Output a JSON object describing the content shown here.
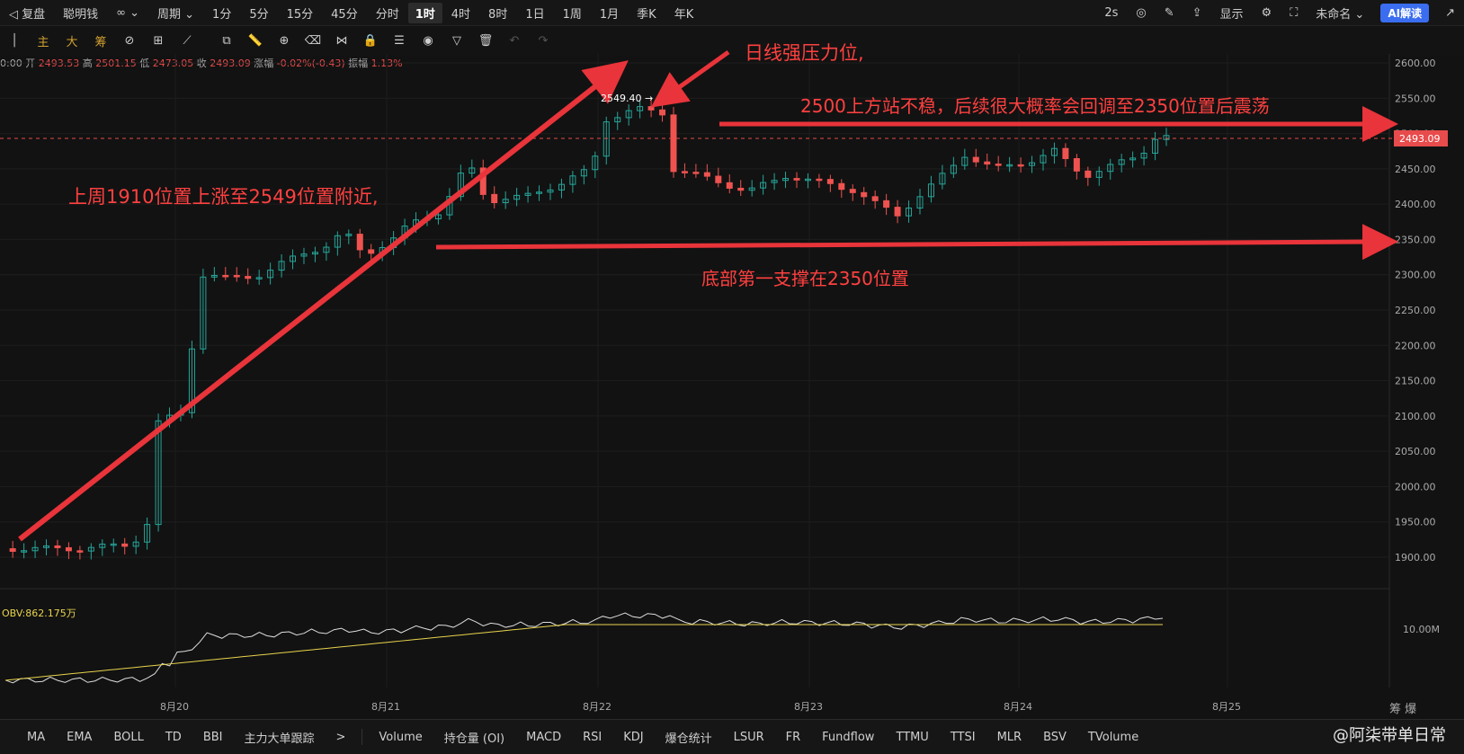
{
  "topbar": {
    "left_items": [
      "◁ 复盘",
      "聪明钱",
      "周期 ⌄"
    ],
    "period_options": [
      "1分",
      "5分",
      "15分",
      "45分",
      "分时",
      "1时",
      "4时",
      "8时",
      "1日",
      "1周",
      "1月",
      "季K",
      "年K"
    ],
    "active_period": "1时",
    "refresh": "2s",
    "display_label": "显示",
    "unnamed_label": "未命名 ⌄",
    "ai_label": "AI解读"
  },
  "drawing_tools": [
    "主",
    "大",
    "筹"
  ],
  "ohlc": {
    "time": "0:00",
    "open_label": "开",
    "open": "2493.53",
    "high_label": "高",
    "high": "2501.15",
    "low_label": "低",
    "low": "2473.05",
    "close_label": "收",
    "close": "2493.09",
    "change_label": "涨幅",
    "change": "-0.02%(-0.43)",
    "amp_label": "振幅",
    "amp": "1.13%"
  },
  "chart_data": {
    "type": "candlestick",
    "y_ticks": [
      2600,
      2550,
      2500,
      2450,
      2400,
      2350,
      2300,
      2250,
      2200,
      2150,
      2100,
      2050,
      2000,
      1950,
      1900
    ],
    "ylim": [
      1870,
      2620
    ],
    "x_labels": [
      "8月20",
      "8月21",
      "8月22",
      "8月23",
      "8月24",
      "8月25"
    ],
    "last_price": "2493.09",
    "peak_label": "2549.40 →",
    "annotations": {
      "daily_resistance": "日线强压力位,",
      "above_2500": "2500上方站不稳，后续很大概率会回调至2350位置后震荡",
      "last_week": "上周1910位置上涨至2549位置附近,",
      "support": "底部第一支撑在2350位置"
    },
    "obv_label": "OBV:862.175万",
    "obv_axis": "10.00M"
  },
  "bottombar": {
    "indicators": [
      "MA",
      "EMA",
      "BOLL",
      "TD",
      "BBI",
      "主力大单跟踪",
      ">",
      "Volume",
      "持仓量 (OI)",
      "MACD",
      "RSI",
      "KDJ",
      "爆仓统计",
      "LSUR",
      "FR",
      "Fundflow",
      "TTMU",
      "TTSI",
      "MLR",
      "BSV",
      "TVolume"
    ],
    "corner": "筹 爆"
  },
  "watermark": "@阿柒带单日常",
  "colors": {
    "up": "#26a69a",
    "down": "#ef5350",
    "arrow": "#e8343a",
    "annotation": "#ff4040"
  }
}
